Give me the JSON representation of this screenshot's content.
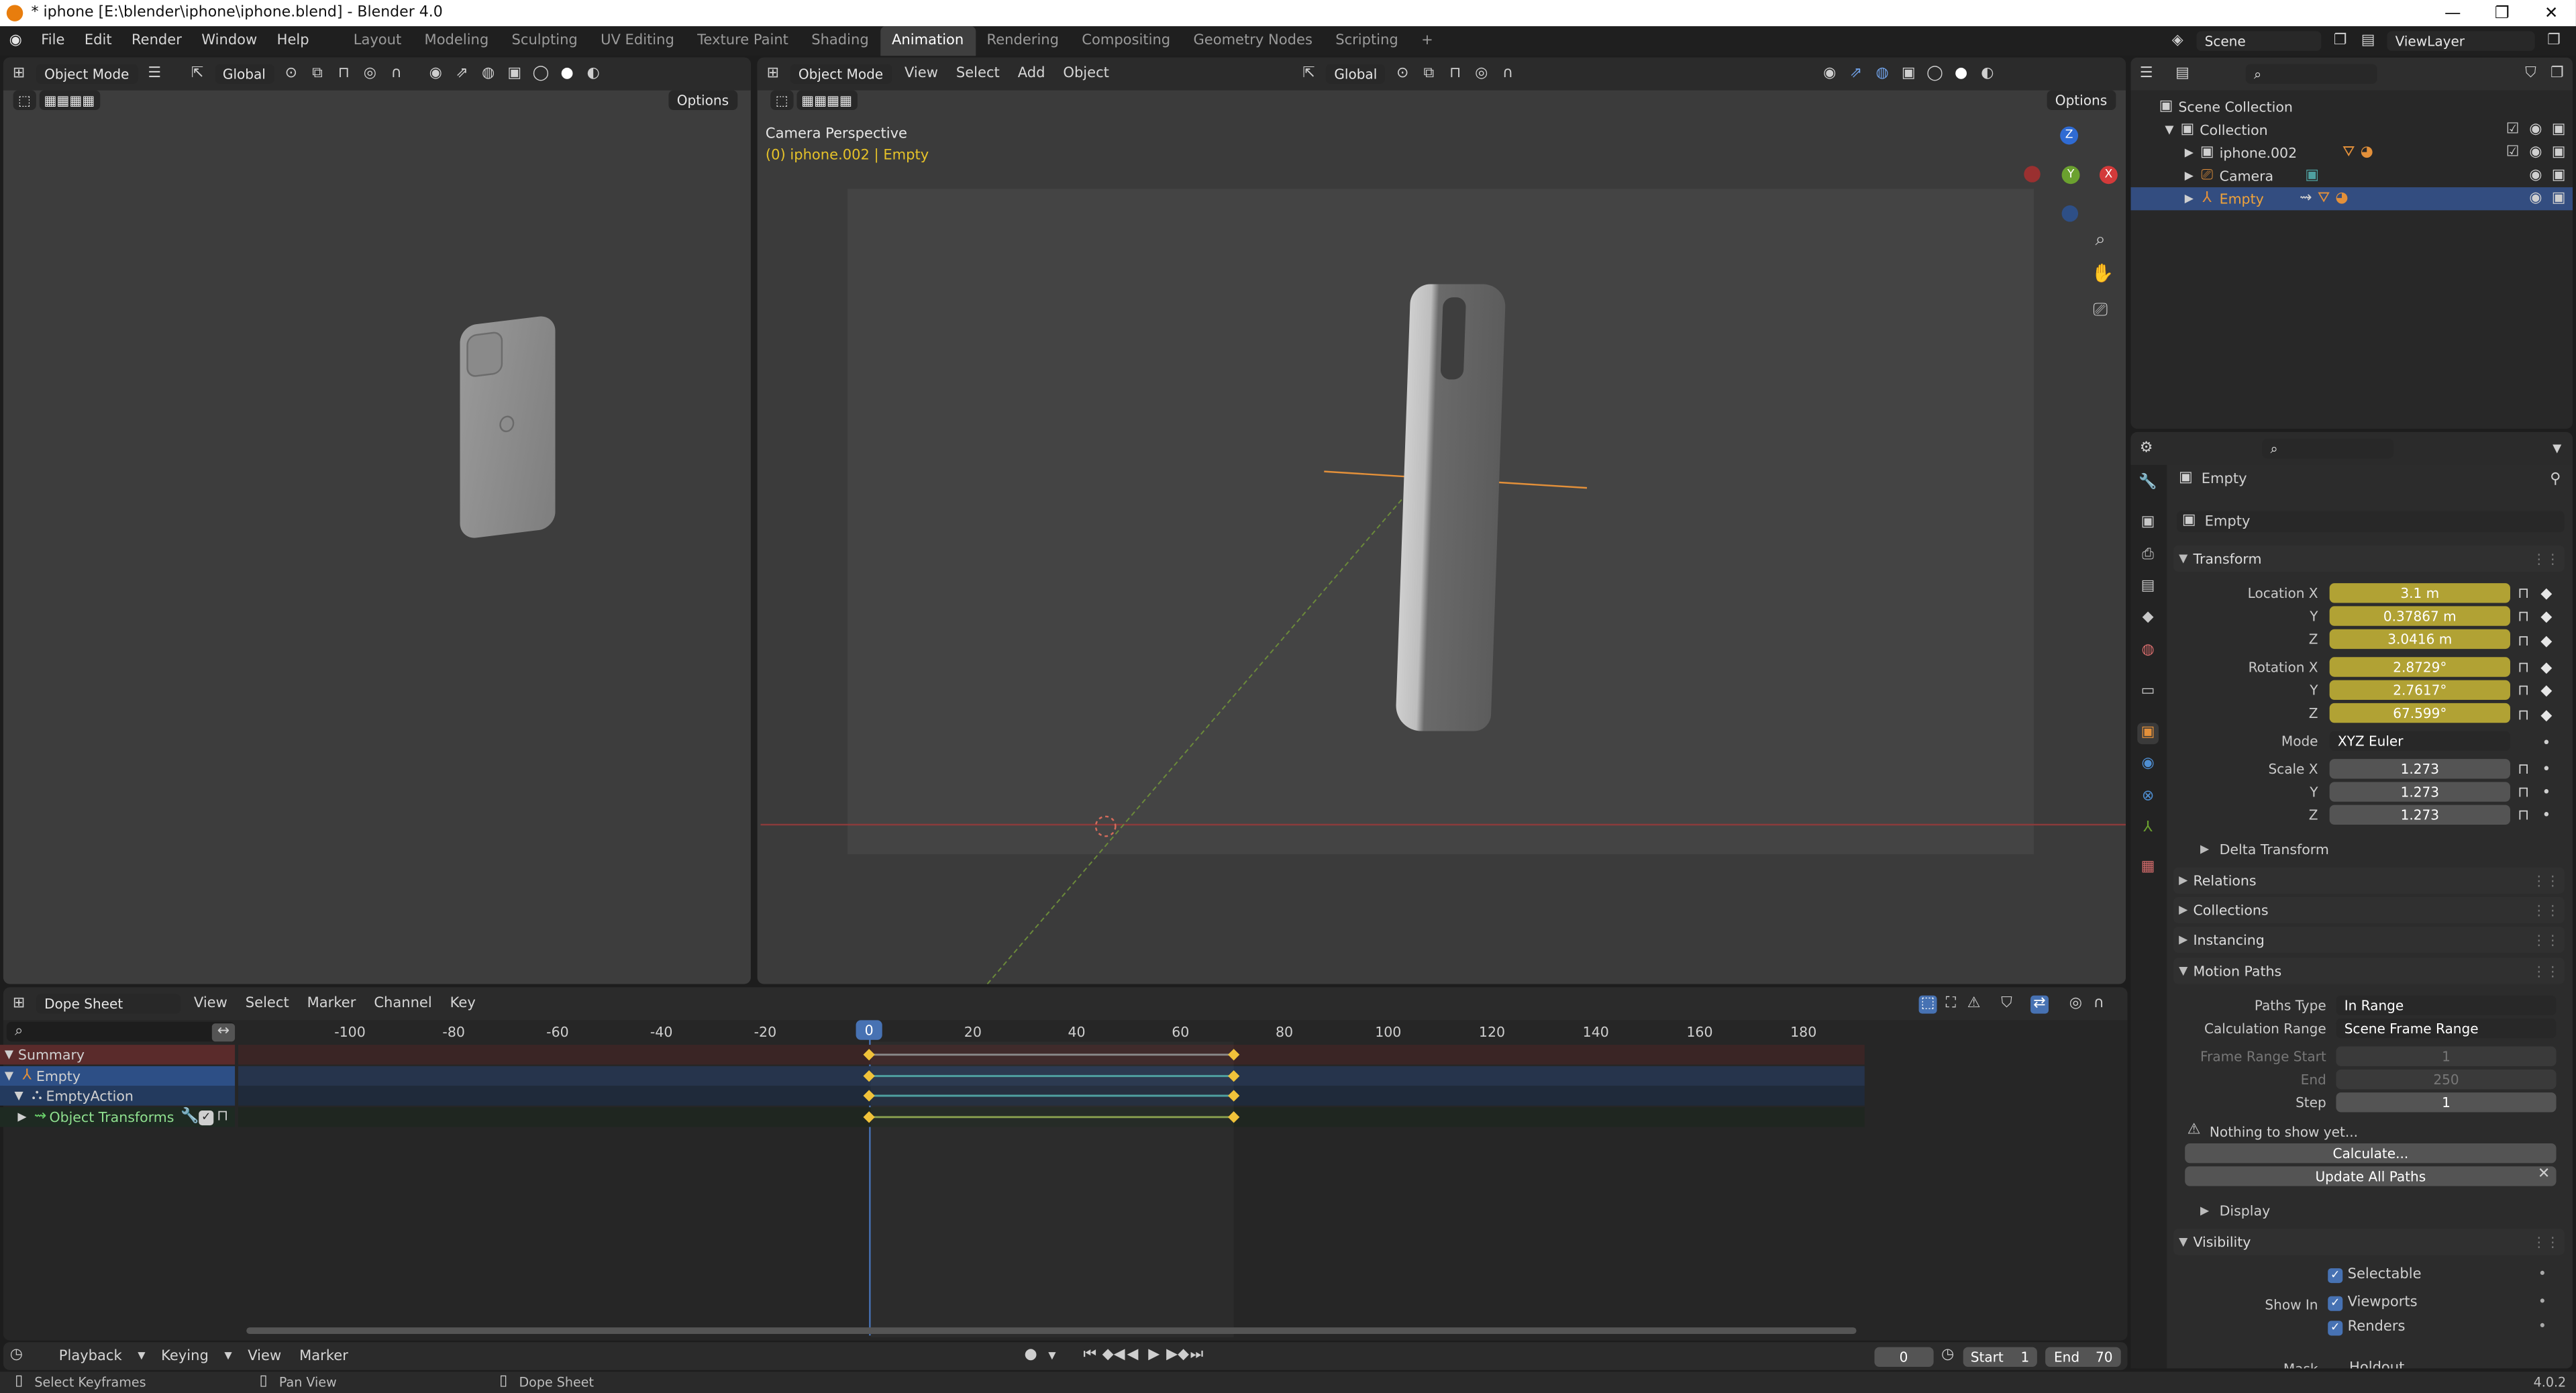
{
  "window": {
    "title": "* iphone [E:\\blender\\iphone\\iphone.blend] - Blender 4.0",
    "minimize": "—",
    "maximize": "❐",
    "close": "✕"
  },
  "menus": [
    "File",
    "Edit",
    "Render",
    "Window",
    "Help"
  ],
  "workspaces": [
    "Layout",
    "Modeling",
    "Sculpting",
    "UV Editing",
    "Texture Paint",
    "Shading",
    "Animation",
    "Rendering",
    "Compositing",
    "Geometry Nodes",
    "Scripting"
  ],
  "active_workspace": "Animation",
  "add_workspace": "+",
  "scene": {
    "label": "Scene",
    "view_layer": "ViewLayer"
  },
  "left_viewport": {
    "mode": "Object Mode",
    "orientation": "Global",
    "options": "Options"
  },
  "main_viewport": {
    "mode": "Object Mode",
    "menus": [
      "View",
      "Select",
      "Add",
      "Object"
    ],
    "orientation": "Global",
    "options": "Options",
    "overlay_title": "Camera Perspective",
    "overlay_subtitle": "(0) iphone.002 | Empty",
    "gizmo_z": "Z",
    "gizmo_y": "Y",
    "gizmo_x": "X"
  },
  "outliner": {
    "root": "Scene Collection",
    "collection": "Collection",
    "items": [
      {
        "name": "iphone.002",
        "selected": false
      },
      {
        "name": "Camera",
        "selected": false
      },
      {
        "name": "Empty",
        "selected": true
      }
    ]
  },
  "properties": {
    "object_name": "Empty",
    "data_name": "Empty",
    "transform_label": "Transform",
    "location_label": "Location X",
    "location": {
      "x": "3.1 m",
      "y": "0.37867 m",
      "z": "3.0416 m"
    },
    "rotation_label": "Rotation X",
    "rotation": {
      "x": "2.8729°",
      "y": "2.7617°",
      "z": "67.599°"
    },
    "y_label": "Y",
    "z_label": "Z",
    "mode_label": "Mode",
    "mode_value": "XYZ Euler",
    "scale_label": "Scale X",
    "scale": {
      "x": "1.273",
      "y": "1.273",
      "z": "1.273"
    },
    "delta_transform": "Delta Transform",
    "relations": "Relations",
    "collections": "Collections",
    "instancing": "Instancing",
    "motion_paths": "Motion Paths",
    "paths_type_label": "Paths Type",
    "paths_type_value": "In Range",
    "calc_range_label": "Calculation Range",
    "calc_range_value": "Scene Frame Range",
    "frame_range_start_label": "Frame Range Start",
    "frame_range_start_value": "1",
    "end_label": "End",
    "end_value": "250",
    "step_label": "Step",
    "step_value": "1",
    "nothing_to_show": "Nothing to show yet...",
    "calculate": "Calculate...",
    "update_all_paths": "Update All Paths",
    "display": "Display",
    "visibility": "Visibility",
    "selectable": "Selectable",
    "show_in_label": "Show In",
    "viewports": "Viewports",
    "renders": "Renders",
    "mask_label": "Mask",
    "holdout": "Holdout"
  },
  "dope_sheet": {
    "editor_type": "Dope Sheet",
    "menus": [
      "View",
      "Select",
      "Marker",
      "Channel",
      "Key"
    ],
    "current_frame": "0",
    "ruler": [
      "-100",
      "-80",
      "-60",
      "-40",
      "-20",
      "20",
      "40",
      "60",
      "80",
      "100",
      "120",
      "140",
      "160",
      "180"
    ],
    "channels": [
      {
        "name": "Summary",
        "kind": "summary"
      },
      {
        "name": "Empty",
        "kind": "object"
      },
      {
        "name": "EmptyAction",
        "kind": "action"
      },
      {
        "name": "Object Transforms",
        "kind": "group"
      }
    ]
  },
  "timeline": {
    "menus": [
      "Playback",
      "Keying",
      "View",
      "Marker"
    ],
    "frame": "0",
    "start_label": "Start",
    "start_value": "1",
    "end_label": "End",
    "end_value": "70"
  },
  "status": {
    "left": "Select Keyframes",
    "middle": "Pan View",
    "right": "Dope Sheet",
    "version": "4.0.2"
  },
  "colors": {
    "accent": "#4772b3",
    "animated_field": "#b1a234",
    "selected_row": "#334d80",
    "summary_row": "#5a2b2b",
    "keyframe": "#f0c23a",
    "playhead": "#4772b3"
  }
}
